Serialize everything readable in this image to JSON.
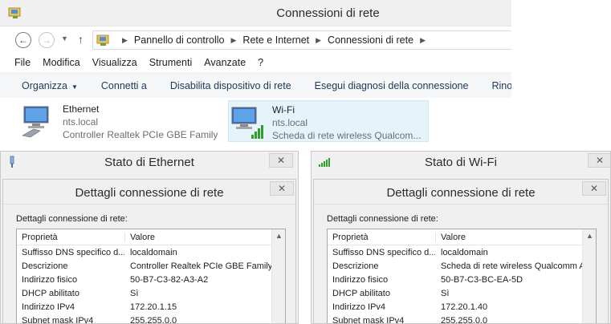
{
  "explorer": {
    "title": "Connessioni di rete",
    "breadcrumb": [
      "Pannello di controllo",
      "Rete e Internet",
      "Connessioni di rete"
    ],
    "menu": [
      "File",
      "Modifica",
      "Visualizza",
      "Strumenti",
      "Avanzate",
      "?"
    ],
    "toolbar": {
      "organize": "Organizza",
      "connect": "Connetti a",
      "disable": "Disabilita dispositivo di rete",
      "diagnose": "Esegui diagnosi della connessione",
      "rename": "Rinomin"
    },
    "connections": [
      {
        "name": "Ethernet",
        "network": "nts.local",
        "adapter": "Controller Realtek PCIe GBE Family",
        "icon": "ethernet-adapter-icon"
      },
      {
        "name": "Wi-Fi",
        "network": "nts.local",
        "adapter": "Scheda di rete wireless Qualcom...",
        "icon": "wifi-adapter-icon"
      }
    ]
  },
  "dialogs": [
    {
      "title": "Stato di Ethernet",
      "close": "✕",
      "inner_title": "Dettagli connessione di rete",
      "section_label": "Dettagli connessione di rete:",
      "columns": [
        "Proprietà",
        "Valore"
      ],
      "rows": [
        [
          "Suffisso DNS specifico d...",
          "localdomain"
        ],
        [
          "Descrizione",
          "Controller Realtek PCIe GBE Family"
        ],
        [
          "Indirizzo fisico",
          "50-B7-C3-82-A3-A2"
        ],
        [
          "DHCP abilitato",
          "Sì"
        ],
        [
          "Indirizzo IPv4",
          "172.20.1.15"
        ],
        [
          "Subnet mask IPv4",
          "255.255.0.0"
        ]
      ]
    },
    {
      "title": "Stato di Wi-Fi",
      "close": "✕",
      "inner_title": "Dettagli connessione di rete",
      "section_label": "Dettagli connessione di rete:",
      "columns": [
        "Proprietà",
        "Valore"
      ],
      "rows": [
        [
          "Suffisso DNS specifico d...",
          "localdomain"
        ],
        [
          "Descrizione",
          "Scheda di rete wireless Qualcomm Ath"
        ],
        [
          "Indirizzo fisico",
          "50-B7-C3-BC-EA-5D"
        ],
        [
          "DHCP abilitato",
          "Sì"
        ],
        [
          "Indirizzo IPv4",
          "172.20.1.40"
        ],
        [
          "Subnet mask IPv4",
          "255.255.0.0"
        ]
      ]
    }
  ],
  "colors": {
    "toolbar_text": "#1e395b",
    "selection": "#e5f3fb",
    "dialog_bg": "#f0f0f0"
  }
}
